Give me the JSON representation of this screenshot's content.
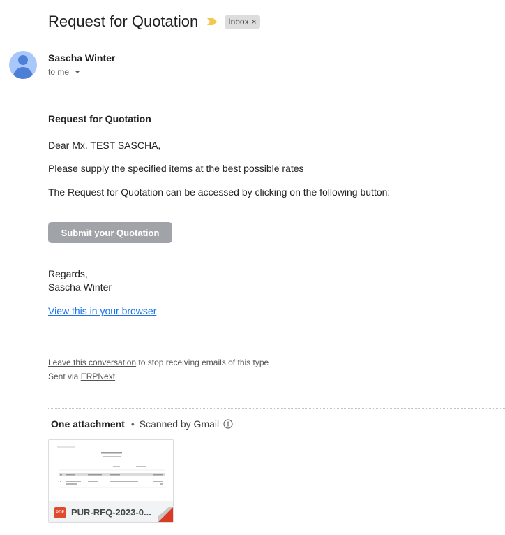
{
  "email": {
    "subject": "Request for Quotation",
    "label": "Inbox",
    "label_close": "×",
    "sender_name": "Sascha Winter",
    "recipient": "to me"
  },
  "message": {
    "heading": "Request for Quotation",
    "greeting": "Dear Mx. TEST SASCHA,",
    "line1": "Please supply the specified items at the best possible rates",
    "line2": "The Request for Quotation can be accessed by clicking on the following button:",
    "button_label": "Submit your Quotation",
    "regards": "Regards,",
    "regards_name": "Sascha Winter",
    "browser_link": "View this in your browser"
  },
  "footer": {
    "leave_link": "Leave this conversation",
    "leave_suffix": " to stop receiving emails of this type",
    "sent_via": "Sent via ",
    "erp_link": "ERPNext"
  },
  "attachments": {
    "title": "One attachment",
    "separator": "•",
    "scanned": "Scanned by Gmail",
    "file_name": "PUR-RFQ-2023-0...",
    "file_type": "PDF"
  },
  "icons": {
    "importance": "importance-marker-icon",
    "info": "info-icon",
    "avatar": "person-avatar-icon"
  },
  "colors": {
    "importance": "#f4b400",
    "link": "#1a73e8",
    "button": "#a0a4a9",
    "pdf": "#e04a2f"
  }
}
